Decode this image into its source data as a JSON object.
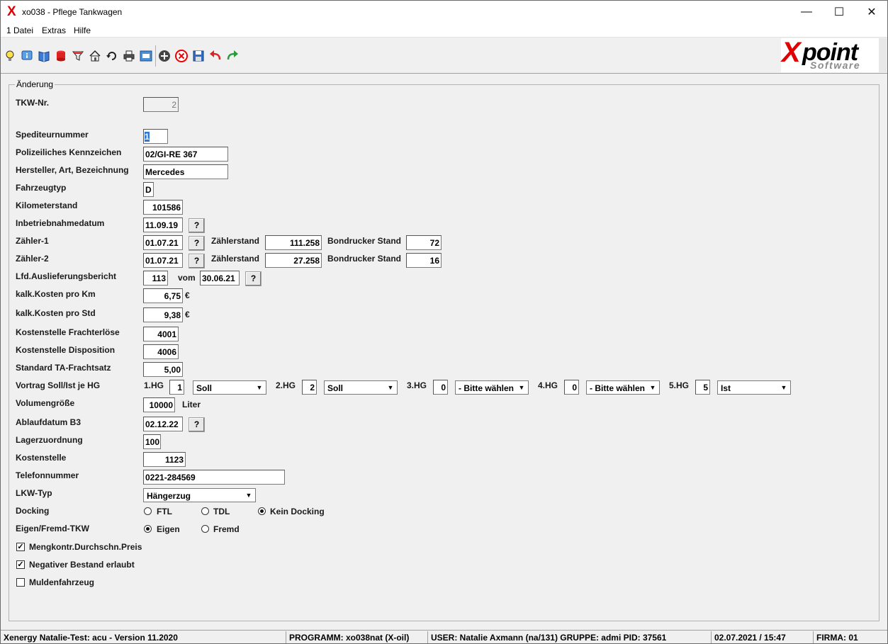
{
  "window": {
    "app_icon": "xpoint-x-icon",
    "title": "xo038 - Pflege Tankwagen",
    "minimize_glyph": "—",
    "maximize_glyph": "☐",
    "close_glyph": "✕"
  },
  "menu": [
    "1 Datei",
    "Extras",
    "Hilfe"
  ],
  "logo": {
    "main_x": "X",
    "main_rest": "point",
    "sub": "Software"
  },
  "group_title": "Änderung",
  "fields": {
    "tkw_nr": {
      "label": "TKW-Nr.",
      "value": "2"
    },
    "spediteur": {
      "label": "Spediteurnummer",
      "value": "1"
    },
    "kennzeichen": {
      "label": "Polizeiliches Kennzeichen",
      "value": "02/GI-RE 367"
    },
    "hersteller": {
      "label": "Hersteller, Art, Bezeichnung",
      "value": "Mercedes"
    },
    "fahrzeugtyp": {
      "label": "Fahrzeugtyp",
      "value": "D"
    },
    "km": {
      "label": "Kilometerstand",
      "value": "101586"
    },
    "inbetrieb": {
      "label": "Inbetriebnahmedatum",
      "value": "11.09.19"
    },
    "zaehler1": {
      "label": "Zähler-1",
      "date": "01.07.21",
      "zs_label": "Zählerstand",
      "zs": "111.258",
      "bd_label": "Bondrucker Stand",
      "bd": "72"
    },
    "zaehler2": {
      "label": "Zähler-2",
      "date": "01.07.21",
      "zs_label": "Zählerstand",
      "zs": "27.258",
      "bd_label": "Bondrucker Stand",
      "bd": "16"
    },
    "lfd": {
      "label": "Lfd.Auslieferungsbericht",
      "value": "113",
      "vom_label": "vom",
      "vom": "30.06.21"
    },
    "kosten_km": {
      "label": "kalk.Kosten  pro Km",
      "value": "6,75",
      "unit": "€"
    },
    "kosten_std": {
      "label": "kalk.Kosten  pro Std",
      "value": "9,38",
      "unit": "€"
    },
    "ks_fracht": {
      "label": "Kostenstelle Frachterlöse",
      "value": "4001"
    },
    "ks_dispo": {
      "label": "Kostenstelle Disposition",
      "value": "4006"
    },
    "ta_fracht": {
      "label": "Standard TA-Frachtsatz",
      "value": "5,00"
    },
    "vortrag": {
      "label": "Vortrag Soll/Ist je HG",
      "hg": [
        {
          "label": "1.HG",
          "value": "1",
          "select": "Soll"
        },
        {
          "label": "2.HG",
          "value": "2",
          "select": "Soll"
        },
        {
          "label": "3.HG",
          "value": "0",
          "select": "- Bitte wählen"
        },
        {
          "label": "4.HG",
          "value": "0",
          "select": "- Bitte wählen"
        },
        {
          "label": "5.HG",
          "value": "5",
          "select": "Ist"
        }
      ]
    },
    "volumen": {
      "label": "Volumengröße",
      "value": "10000",
      "unit": "Liter"
    },
    "ablauf_b3": {
      "label": "Ablaufdatum B3",
      "value": "02.12.22"
    },
    "lager": {
      "label": "Lagerzuordnung",
      "value": "100"
    },
    "kostenstelle": {
      "label": "Kostenstelle",
      "value": "1123"
    },
    "telefon": {
      "label": "Telefonnummer",
      "value": "0221-284569"
    },
    "lkw_typ": {
      "label": "LKW-Typ",
      "value": "Hängerzug"
    },
    "docking": {
      "label": "Docking",
      "options": [
        "FTL",
        "TDL",
        "Kein Docking"
      ],
      "selected": "Kein Docking"
    },
    "eigen_fremd": {
      "label": "Eigen/Fremd-TKW",
      "options": [
        "Eigen",
        "Fremd"
      ],
      "selected": "Eigen"
    },
    "checkboxes": [
      {
        "label": "Mengkontr.Durchschn.Preis",
        "checked": true
      },
      {
        "label": "Negativer Bestand erlaubt",
        "checked": true
      },
      {
        "label": "Muldenfahrzeug",
        "checked": false
      }
    ]
  },
  "q_button": "?",
  "checkmark": "✓",
  "combo_arrow": "▼",
  "status": {
    "app": "Xenergy Natalie-Test: acu - Version 11.2020",
    "programm": "PROGRAMM: xo038nat (X-oil)",
    "user": "USER: Natalie Axmann (na/131)  GRUPPE: admi  PID: 37561",
    "datetime": "02.07.2021 / 15:47",
    "firma": "FIRMA: 01"
  },
  "toolbar_icons": [
    "lightbulb-icon",
    "info-icon",
    "book-icon",
    "database-icon",
    "filter-icon",
    "home-icon",
    "refresh-icon",
    "printer-icon",
    "window-icon",
    "add-icon",
    "delete-icon",
    "save-icon",
    "undo-icon",
    "redo-icon"
  ],
  "colors": {
    "accent_red": "#e00000",
    "selection_blue": "#3078d6"
  }
}
